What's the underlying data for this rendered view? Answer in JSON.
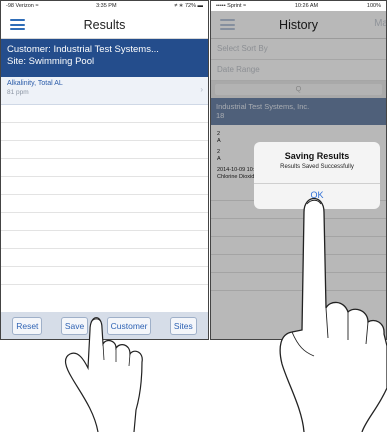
{
  "left": {
    "status": {
      "carrier": "-98 Verizon ≈",
      "time": "3:35 PM",
      "battery": "≠ ∗ 72% ▬"
    },
    "title": "Results",
    "banner": {
      "customer": "Customer: Industrial Test Systems...",
      "site": "Site: Swimming Pool"
    },
    "result": {
      "name": "Alkalinity, Total AL",
      "value": "81 ppm"
    },
    "toolbar": {
      "reset": "Reset",
      "save": "Save",
      "customer": "Customer",
      "sites": "Sites"
    },
    "blank_rows": 10
  },
  "right": {
    "status": {
      "carrier": "••••• Sprint ≈",
      "time": "10:26 AM",
      "battery": "100%"
    },
    "title": "History",
    "right_action": "Ma",
    "select_label": "Select  Sort By",
    "date_label": "Date Range",
    "search_placeholder": "Q",
    "org_header": {
      "line1": "Industrial Test Systems, Inc.",
      "line2": "18"
    },
    "entries": [
      {
        "line1": "2",
        "line2": "A"
      },
      {
        "line1": "2",
        "line2": "A"
      },
      {
        "line1": "2014-10-09 10:25AM",
        "line2": "Chlorine Dioxide (DPD-1)         m"
      }
    ],
    "alert": {
      "title": "Saving Results",
      "message": "Results Saved Successfully",
      "button": "OK"
    }
  },
  "colors": {
    "banner": "#244d8c",
    "accent": "#2f63b4",
    "toolbar": "#d6dde8"
  }
}
